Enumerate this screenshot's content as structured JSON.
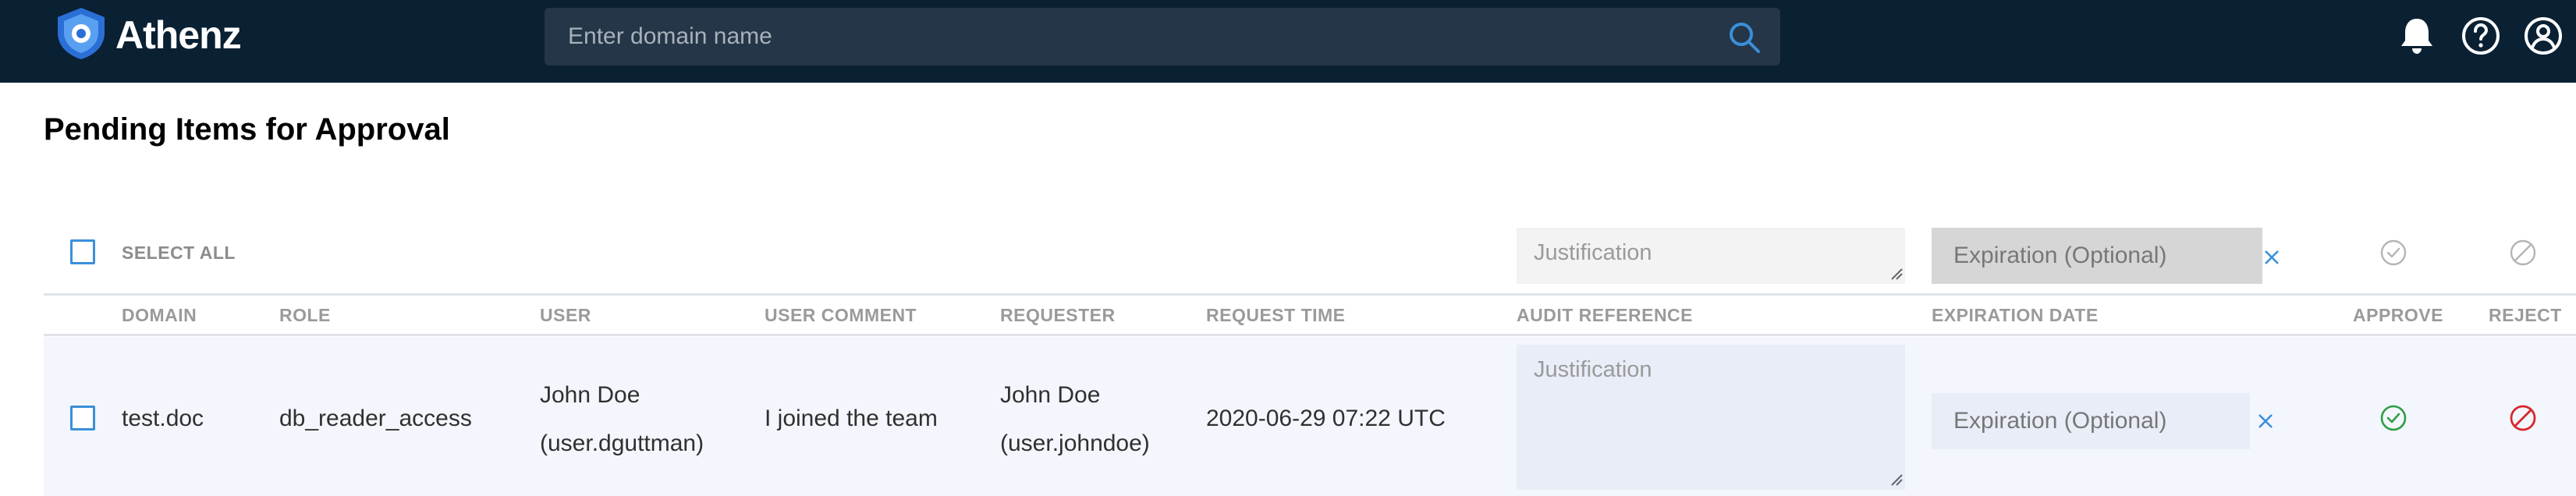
{
  "header": {
    "brand": "Athenz",
    "search": {
      "placeholder": "Enter domain name"
    },
    "colors": {
      "background": "#0a2033",
      "search_bg": "#243647",
      "accent": "#3a8fd9"
    },
    "icons": [
      "bell-icon",
      "help-icon",
      "user-profile-icon"
    ]
  },
  "page": {
    "title": "Pending Items for Approval"
  },
  "bulk_actions": {
    "select_all_label": "SELECT ALL",
    "justification_placeholder": "Justification",
    "expiration_placeholder": "Expiration (Optional)"
  },
  "table": {
    "columns": {
      "domain": "DOMAIN",
      "role": "ROLE",
      "user": "USER",
      "user_comment": "USER COMMENT",
      "requester": "REQUESTER",
      "request_time": "REQUEST TIME",
      "audit_reference": "AUDIT REFERENCE",
      "expiration_date": "EXPIRATION DATE",
      "approve": "APPROVE",
      "reject": "REJECT"
    },
    "rows": [
      {
        "domain": "test.doc",
        "role": "db_reader_access",
        "user_name": "John Doe",
        "user_id": "(user.dguttman)",
        "user_comment": "I joined the team",
        "requester_name": "John Doe",
        "requester_id": "(user.johndoe)",
        "request_time": "2020-06-29 07:22 UTC",
        "justification_placeholder": "Justification",
        "expiration_placeholder": "Expiration (Optional)"
      }
    ]
  },
  "status_colors": {
    "approve": "#2e9e44",
    "reject": "#d6282b",
    "disabled": "#b5b5b5"
  }
}
